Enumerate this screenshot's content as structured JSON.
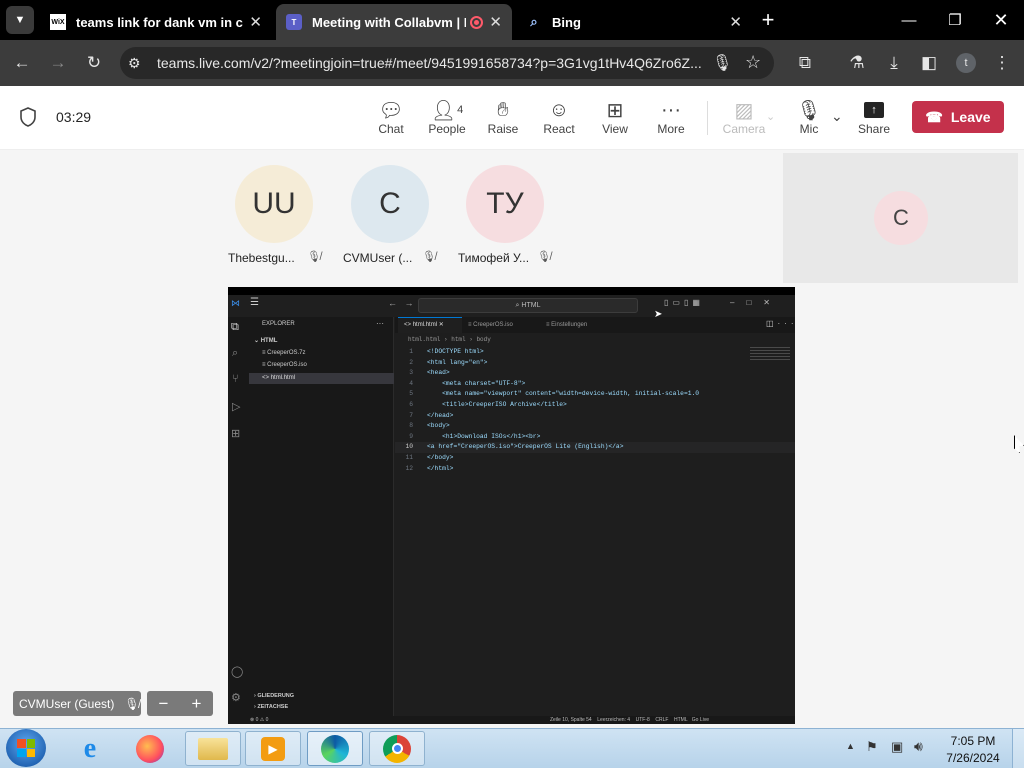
{
  "browser": {
    "tabs": [
      {
        "title": "teams link for dank vm in com",
        "favicon": "WiX",
        "active": false
      },
      {
        "title": "Meeting with Collabvm | M",
        "favicon": "teams-icon",
        "active": true
      },
      {
        "title": "Bing",
        "favicon": "search-icon",
        "active": false
      }
    ],
    "url": "teams.live.com/v2/?meetingjoin=true#/meet/9451991658734?p=3G1vg1tHv4Q6Zro6Z...",
    "profile_initial": "t"
  },
  "meeting": {
    "timer": "03:29",
    "toolbar": {
      "chat": "Chat",
      "people": "People",
      "people_count": "4",
      "raise": "Raise",
      "react": "React",
      "view": "View",
      "more": "More",
      "camera": "Camera",
      "mic": "Mic",
      "share": "Share",
      "leave": "Leave"
    },
    "participants": [
      {
        "initials": "UU",
        "name": "Thebestgu...",
        "color": "#f5ecd7"
      },
      {
        "initials": "C",
        "name": "CVMUser (...",
        "color": "#dde8ef"
      },
      {
        "initials": "ТУ",
        "name": "Тимофей У...",
        "color": "#f6dde0"
      }
    ],
    "self_tile": {
      "initial": "C"
    },
    "self_label": "CVMUser (Guest)",
    "zoom_minus": "−",
    "zoom_plus": "+"
  },
  "vscode": {
    "search": "HTML",
    "explorer_title": "EXPLORER",
    "folder": "HTML",
    "files": [
      "CreeperOS.7z",
      "CreeperOS.iso",
      "html.html"
    ],
    "tabs": [
      "html.html",
      "CreeperOS.iso",
      "Einstellungen"
    ],
    "breadcrumb": [
      "html.html",
      "html",
      "body"
    ],
    "code_lines": [
      {
        "n": "1",
        "t": "<!DOCTYPE html>"
      },
      {
        "n": "2",
        "t": "<html lang=\"en\">"
      },
      {
        "n": "3",
        "t": "<head>"
      },
      {
        "n": "4",
        "t": "    <meta charset=\"UTF-8\">"
      },
      {
        "n": "5",
        "t": "    <meta name=\"viewport\" content=\"width=device-width, initial-scale=1.0"
      },
      {
        "n": "6",
        "t": "    <title>CreeperISO Archive</title>"
      },
      {
        "n": "7",
        "t": "</head>"
      },
      {
        "n": "8",
        "t": "<body>"
      },
      {
        "n": "9",
        "t": "    <h1>Download ISOs</h1><br>"
      },
      {
        "n": "10",
        "t": "<a href=\"CreeperOS.iso\">CreeperOS Lite (English)</a>"
      },
      {
        "n": "11",
        "t": "</body>"
      },
      {
        "n": "12",
        "t": "</html>"
      }
    ],
    "outline": "GLIEDERUNG",
    "timeline": "ZEITACHSE",
    "status_left": "⊗ 0 ⚠ 0",
    "status_right": [
      "Zeile 10, Spalte 54",
      "Leerzeichen: 4",
      "UTF-8",
      "CRLF",
      "HTML",
      "Go Live"
    ]
  },
  "taskbar": {
    "time": "7:05 PM",
    "date": "7/26/2024",
    "apps": [
      "internet-explorer-icon",
      "firefox-icon",
      "file-explorer-icon",
      "media-player-icon",
      "edge-icon",
      "chrome-icon"
    ]
  },
  "colors": {
    "leave": "#c4314b",
    "teams_accent": "#5b5fc7"
  }
}
